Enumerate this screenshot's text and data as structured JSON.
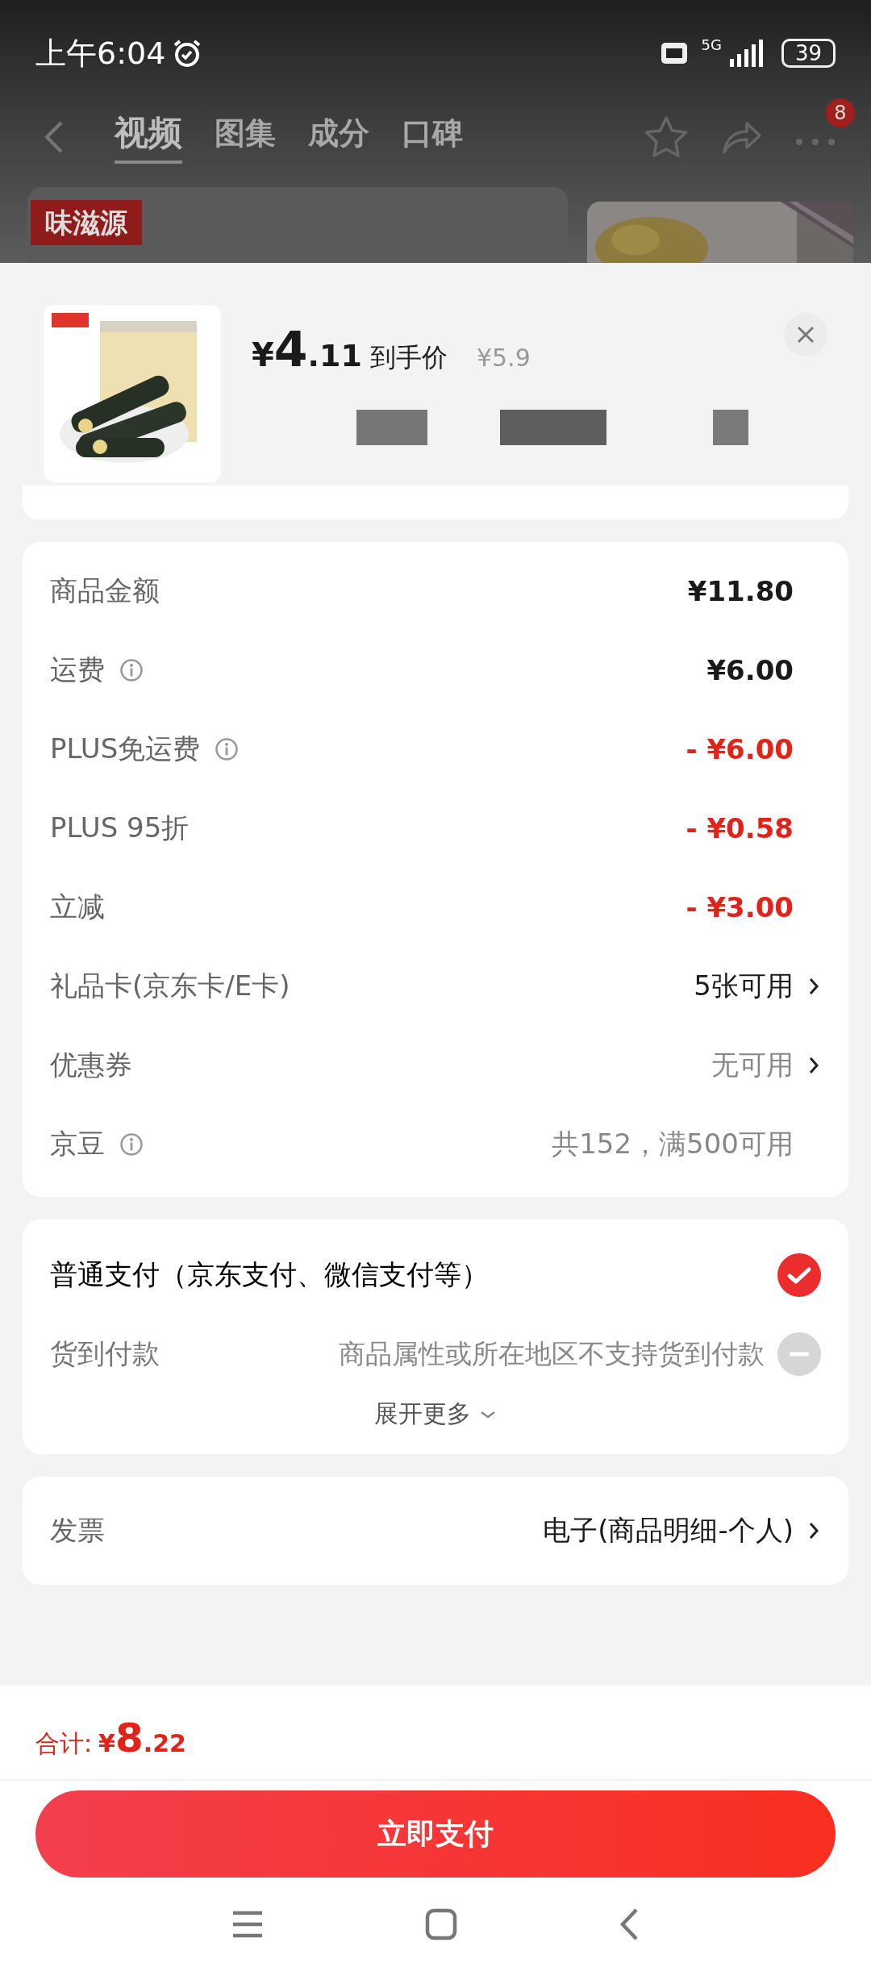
{
  "status_bar": {
    "time": "上午6:04",
    "network": "5G",
    "battery": "39"
  },
  "nav": {
    "tabs": [
      {
        "label": "视频",
        "selected": true
      },
      {
        "label": "图集",
        "selected": false
      },
      {
        "label": "成分",
        "selected": false
      },
      {
        "label": "口碑",
        "selected": false
      }
    ],
    "more_badge": "8"
  },
  "backdrop": {
    "brand_tag": "味滋源"
  },
  "product": {
    "currency": "¥",
    "price_int": "4",
    "price_dec": ".11",
    "price_label": "到手价",
    "original_price": "¥5.9"
  },
  "summary": [
    {
      "label": "商品金额",
      "info": false,
      "kind": "amount",
      "value": "¥11.80"
    },
    {
      "label": "运费",
      "info": true,
      "kind": "amount",
      "value": "¥6.00"
    },
    {
      "label": "PLUS免运费",
      "info": true,
      "kind": "discount",
      "value": "- ¥6.00"
    },
    {
      "label": "PLUS 95折",
      "info": false,
      "kind": "discount",
      "value": "- ¥0.58"
    },
    {
      "label": "立减",
      "info": false,
      "kind": "discount",
      "value": "- ¥3.00"
    },
    {
      "label": "礼品卡(京东卡/E卡)",
      "info": false,
      "kind": "option",
      "value": "5张可用"
    },
    {
      "label": "优惠券",
      "info": false,
      "kind": "muted_option",
      "value": "无可用"
    },
    {
      "label": "京豆",
      "info": true,
      "kind": "note",
      "value": "共152，满500可用"
    }
  ],
  "payment": {
    "methods": [
      {
        "label": "普通支付（京东支付、微信支付等）",
        "selected": true,
        "disabled": false
      },
      {
        "label": "货到付款",
        "note": "商品属性或所在地区不支持货到付款",
        "selected": false,
        "disabled": true
      }
    ],
    "expand": "展开更多"
  },
  "invoice": {
    "label": "发票",
    "value": "电子(商品明细-个人)"
  },
  "total": {
    "label": "合计:",
    "currency": "¥",
    "int": "8",
    "dec": ".22"
  },
  "pay_button": "立即支付"
}
